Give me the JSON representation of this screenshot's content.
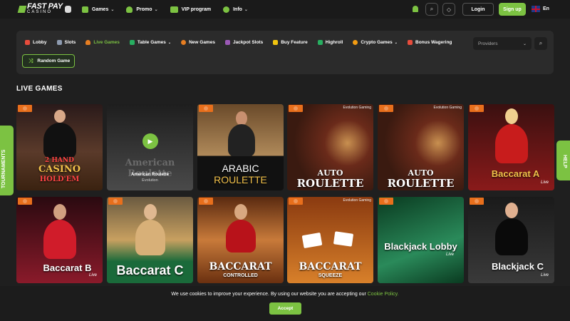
{
  "header": {
    "logo_top": "FAST PAY",
    "logo_bottom": "CASINO",
    "nav": [
      {
        "label": "Games",
        "dropdown": true,
        "color": "#7cc242"
      },
      {
        "label": "Promo",
        "dropdown": true,
        "color": "#7cc242"
      },
      {
        "label": "VIP program",
        "dropdown": false,
        "color": "#7cc242"
      },
      {
        "label": "Info",
        "dropdown": true,
        "color": "#7cc242"
      }
    ],
    "login_label": "Login",
    "signup_label": "Sign up",
    "language": "En"
  },
  "categories": {
    "items": [
      {
        "label": "Lobby",
        "active": false,
        "dropdown": false,
        "color": "#e74c3c"
      },
      {
        "label": "Slots",
        "active": false,
        "dropdown": false,
        "color": "#8e9bb0"
      },
      {
        "label": "Live Games",
        "active": true,
        "dropdown": false,
        "color": "#e67e22"
      },
      {
        "label": "Table Games",
        "active": false,
        "dropdown": true,
        "color": "#27ae60"
      },
      {
        "label": "New Games",
        "active": false,
        "dropdown": false,
        "color": "#e67e22"
      },
      {
        "label": "Jackpot Slots",
        "active": false,
        "dropdown": false,
        "color": "#9b59b6"
      },
      {
        "label": "Buy Feature",
        "active": false,
        "dropdown": false,
        "color": "#f1c40f"
      },
      {
        "label": "Highroll",
        "active": false,
        "dropdown": false,
        "color": "#27ae60"
      },
      {
        "label": "Crypto Games",
        "active": false,
        "dropdown": true,
        "color": "#f39c12"
      },
      {
        "label": "Bonus Wagering",
        "active": false,
        "dropdown": false,
        "color": "#e74c3c"
      }
    ],
    "providers_placeholder": "Providers",
    "random_label": "Random Game"
  },
  "section_title": "LIVE GAMES",
  "games_row1": [
    {
      "title": "2 HAND CASINO HOLD'EM",
      "line1": "2 HAND",
      "line2": "CASINO",
      "line3": "HOLD'EM",
      "bg": "#5a3a2a"
    },
    {
      "title": "American Roulette",
      "provider": "Evolution",
      "hovered": true,
      "bg": "#3a3a3a"
    },
    {
      "title": "ARABIC ROULETTE",
      "line1": "ARABIC",
      "line2": "ROULETTE",
      "bg": "#8a6a3a"
    },
    {
      "title": "AUTO ROULETTE",
      "line1": "AUTO",
      "line2": "ROULETTE",
      "provider_tag": "Evolution Gaming",
      "bg": "#6a2a1a"
    },
    {
      "title": "AUTO ROULETTE",
      "line1": "AUTO",
      "line2": "ROULETTE",
      "provider_tag": "Evolution Gaming",
      "bg": "#6a2a1a"
    },
    {
      "title": "Baccarat A",
      "sub": "Live",
      "bg": "#7a1a1a"
    }
  ],
  "games_row2": [
    {
      "title": "Baccarat B",
      "sub": "Live",
      "bg": "#8a1a2a"
    },
    {
      "title": "Baccarat C",
      "bg": "#c8a060"
    },
    {
      "title": "BACCARAT CONTROLLED",
      "line1": "BACCARAT",
      "line2": "CONTROLLED",
      "bg": "#8a4a1a"
    },
    {
      "title": "BACCARAT SQUEEZE",
      "line1": "BACCARAT",
      "line2": "SQUEEZE",
      "provider_tag": "Evolution Gaming",
      "bg": "#b85a1a"
    },
    {
      "title": "Blackjack Lobby",
      "line1": "Blackjack Lobby",
      "line2": "Live",
      "bg": "#1a5a3a"
    },
    {
      "title": "Blackjack C",
      "sub": "Live",
      "bg": "#2a2a2a"
    }
  ],
  "side": {
    "tournaments": "TOURNAMENTS",
    "help": "HELP"
  },
  "cookie": {
    "text": "We use cookies to improve your experience. By using our website you are accepting our",
    "link": "Cookie Policy.",
    "accept": "Accept"
  },
  "colors": {
    "accent": "#7cc242",
    "background": "#1f1f1f",
    "panel": "#2b2b2b"
  }
}
